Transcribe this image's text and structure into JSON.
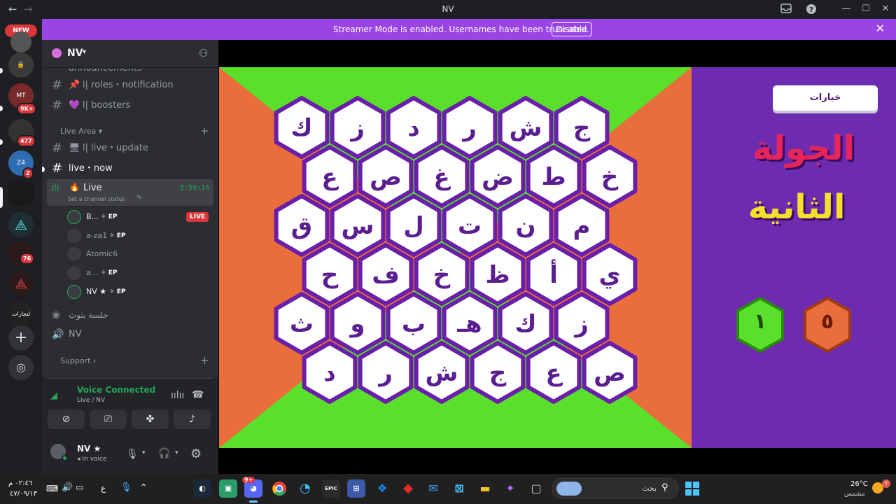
{
  "window": {
    "title": "NV",
    "back": "←",
    "forward": "→"
  },
  "guild_rail": {
    "new_badge": "NEW",
    "badges": [
      "9K+",
      "477",
      "2",
      "76"
    ],
    "labels": [
      "MT",
      "Z4",
      "لتجارات"
    ]
  },
  "banner": {
    "text": "Streamer Mode is enabled. Usernames have been truncated.",
    "button": "Disable"
  },
  "server": {
    "name": "NV"
  },
  "channels": {
    "partial": "announcements",
    "roles": "ا| roles・notification",
    "boosters": "ا| boosters",
    "category_live": "Live Area",
    "live_update": "ا| live・update",
    "live_now": "live・now",
    "voice_live": "Live",
    "voice_status": "Set a channel status",
    "voice_timer": "5:59:14",
    "voice_jalsa": "جلسة بثوث",
    "voice_nv": "NV",
    "category_support": "Support"
  },
  "members": [
    {
      "name": "B...",
      "ep": "EP",
      "live": "LIVE"
    },
    {
      "name": "a-za1",
      "ep": "EP",
      "live": ""
    },
    {
      "name": "Atomic6",
      "ep": "",
      "live": ""
    },
    {
      "name": "a...",
      "ep": "EP",
      "live": ""
    },
    {
      "name": "NV ★",
      "ep": "EP",
      "live": ""
    }
  ],
  "voice_connected": {
    "title": "Voice Connected",
    "sub": "Live / NV"
  },
  "user": {
    "name": "NV ★",
    "status": "In voice"
  },
  "game": {
    "options_button": "خيارات",
    "title_line1": "الجولة",
    "title_line2": "الثانية",
    "score_green": "١",
    "score_orange": "٥",
    "rows": [
      [
        "ك",
        "ز",
        "د",
        "ر",
        "ش",
        "ج"
      ],
      [
        "ع",
        "ص",
        "غ",
        "ض",
        "ط",
        "خ"
      ],
      [
        "ق",
        "س",
        "ل",
        "ت",
        "ن",
        "م"
      ],
      [
        "ح",
        "ف",
        "خ",
        "ظ",
        "أ",
        "ي"
      ],
      [
        "ث",
        "و",
        "ب",
        "هـ",
        "ك",
        "ز"
      ],
      [
        "د",
        "ر",
        "ش",
        "ج",
        "ع",
        "ص"
      ]
    ]
  },
  "taskbar": {
    "time": "٠٢:٤٦ م",
    "date": "٤٧/٠٩/١٣",
    "lang": "ع",
    "search": "بحث",
    "weather_temp": "26°C",
    "weather_desc": "مشمس",
    "discord_badge": "9+",
    "epic": "EPIC"
  },
  "colors": {
    "banner": "#9b44e6",
    "board_orange": "#ea6d3c",
    "board_green": "#5ae02a",
    "purple": "#6d2bb0",
    "voice_green": "#23a55a",
    "live_red": "#da373c"
  }
}
